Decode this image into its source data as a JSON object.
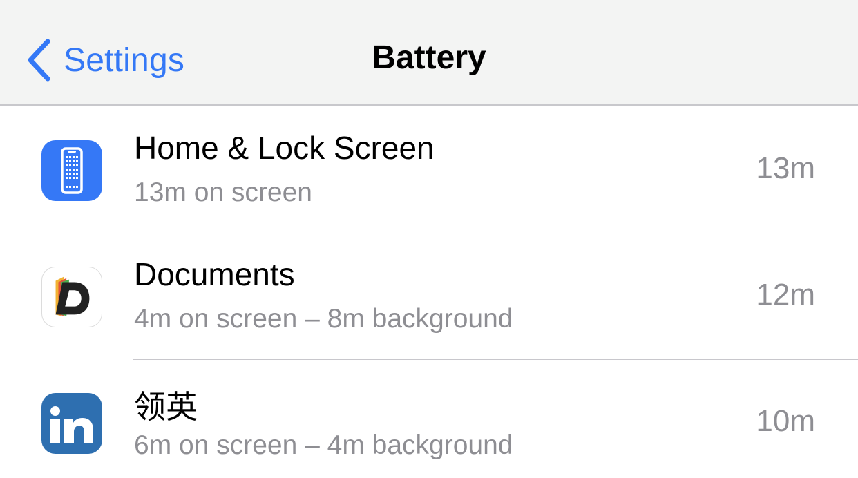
{
  "nav": {
    "back_label": "Settings",
    "title": "Battery",
    "accent_color": "#3478f6"
  },
  "apps": [
    {
      "name": "Home & Lock Screen",
      "detail": "13m on screen",
      "total": "13m",
      "icon": "phone-screen-icon",
      "icon_color": "#3578f6"
    },
    {
      "name": "Documents",
      "detail": "4m on screen – 8m background",
      "total": "12m",
      "icon": "documents-app-icon",
      "icon_color": "#ffffff"
    },
    {
      "name": "领英",
      "detail": "6m on screen – 4m background",
      "total": "10m",
      "icon": "linkedin-app-icon",
      "icon_color": "#2e6fb0"
    }
  ]
}
